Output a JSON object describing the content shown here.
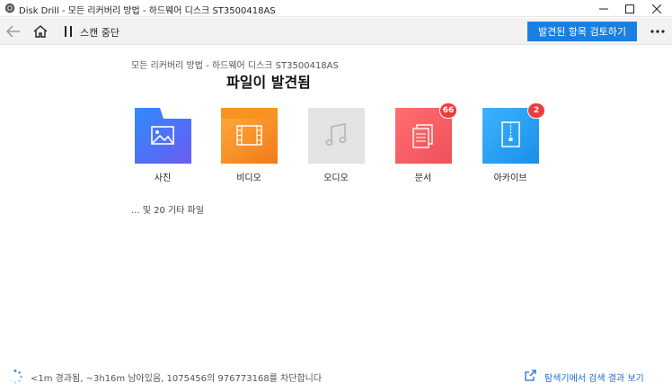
{
  "window": {
    "title": "Disk Drill - 모든 리커버리 방법 - 하드웨어 디스크 ST3500418AS"
  },
  "toolbar": {
    "stop_label": "스캔 중단",
    "review_button_label": "발견된 항목 검토하기",
    "accent_color": "#1a7fe0"
  },
  "header": {
    "subtitle": "모든 리커버리 방법 - 하드웨어 디스크 ST3500418AS",
    "title": "파일이 발견됨"
  },
  "categories": [
    {
      "label": "사진",
      "icon": "image-icon",
      "badge": null
    },
    {
      "label": "비디오",
      "icon": "film-icon",
      "badge": null
    },
    {
      "label": "오디오",
      "icon": "music-note-icon",
      "badge": null
    },
    {
      "label": "문서",
      "icon": "document-icon",
      "badge": "66"
    },
    {
      "label": "아카이브",
      "icon": "archive-icon",
      "badge": "2"
    }
  ],
  "other_files": "... 및 20 기타 파일",
  "footer": {
    "status": "<1m 경과됨, ~3h16m 남아있음, 1075456의 976773168를 차단합니다",
    "explorer_link": "탐색기에서 검색 결과 보기"
  }
}
